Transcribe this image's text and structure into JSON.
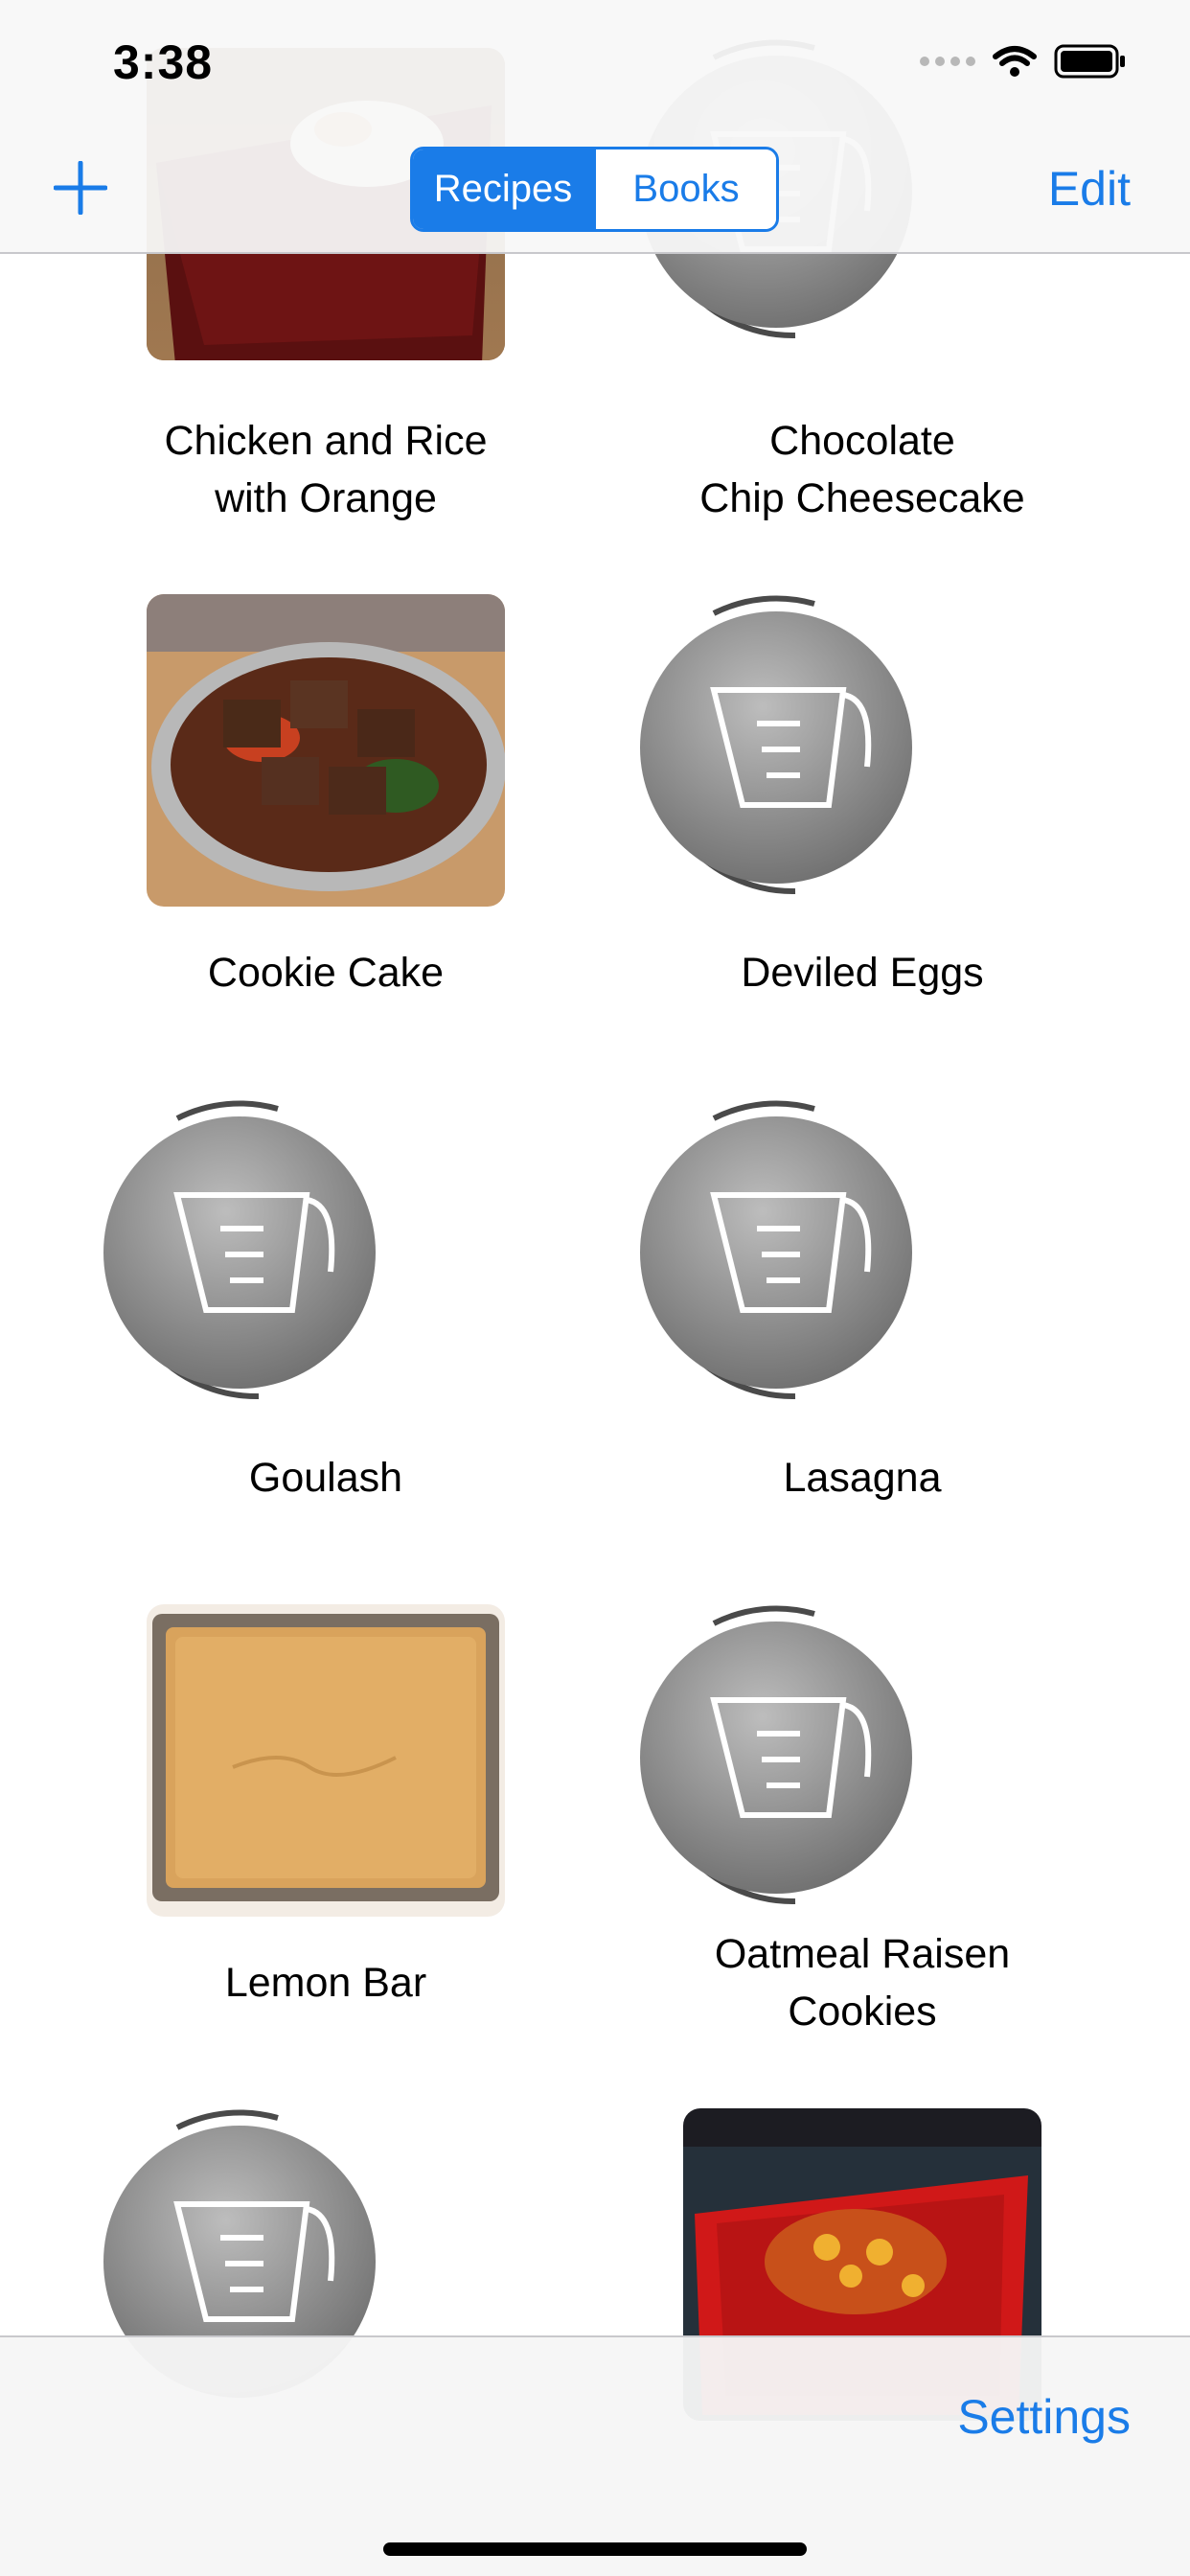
{
  "status_bar": {
    "time": "3:38"
  },
  "nav": {
    "segments": [
      {
        "label": "Recipes",
        "selected": true
      },
      {
        "label": "Books",
        "selected": false
      }
    ],
    "edit_label": "Edit"
  },
  "recipes": [
    {
      "line1": "Chicken and Rice",
      "line2": "with Orange",
      "thumbnail": "chicken-rice-photo"
    },
    {
      "line1": "Chocolate",
      "line2": "Chip Cheesecake",
      "thumbnail": "measuring-cup-icon"
    },
    {
      "line1": "Cookie Cake",
      "line2": "",
      "thumbnail": "cookie-cake-photo"
    },
    {
      "line1": "Deviled Eggs",
      "line2": "",
      "thumbnail": "measuring-cup-icon"
    },
    {
      "line1": "Goulash",
      "line2": "",
      "thumbnail": "measuring-cup-icon"
    },
    {
      "line1": "Lasagna",
      "line2": "",
      "thumbnail": "measuring-cup-icon"
    },
    {
      "line1": "Lemon Bar",
      "line2": "",
      "thumbnail": "lemon-bar-photo"
    },
    {
      "line1": "Oatmeal Raisen",
      "line2": "Cookies",
      "thumbnail": "measuring-cup-icon"
    },
    {
      "line1": "",
      "line2": "",
      "thumbnail": "measuring-cup-icon"
    },
    {
      "line1": "",
      "line2": "",
      "thumbnail": "red-plate-photo"
    }
  ],
  "toolbar": {
    "settings_label": "Settings"
  },
  "colors": {
    "accent": "#1a7ce8",
    "separator": "#c8c8cc"
  }
}
